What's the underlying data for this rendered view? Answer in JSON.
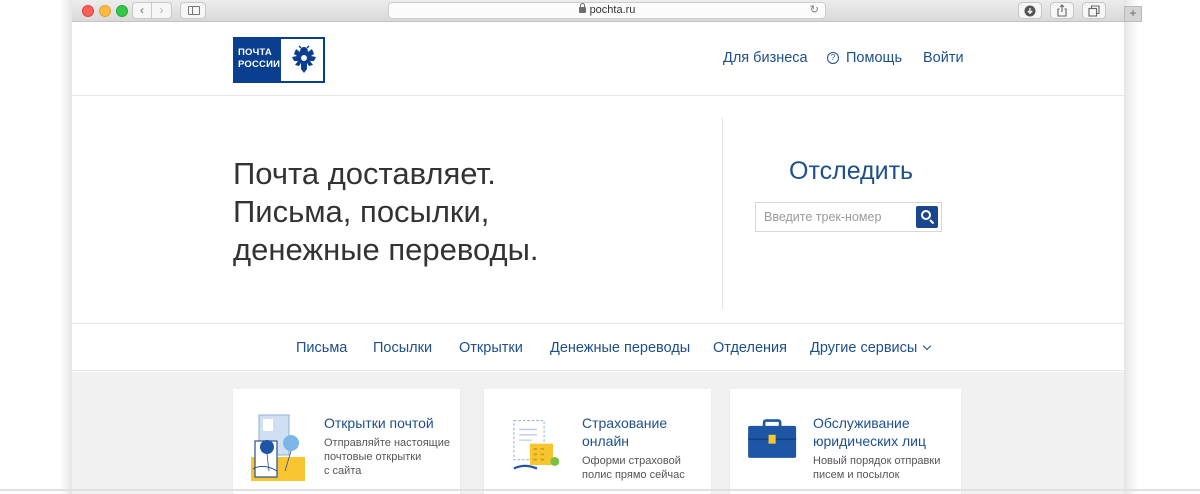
{
  "browser": {
    "url": "pochta.ru",
    "back_icon": "chevron-left-icon",
    "forward_icon": "chevron-right-icon",
    "reload_icon": "reload-icon",
    "plus_label": "+"
  },
  "header": {
    "logo_line1": "ПОЧТА",
    "logo_line2": "РОССИИ",
    "business_link": "Для бизнеса",
    "help_link": "Помощь",
    "login_link": "Войти"
  },
  "hero": {
    "line1": "Почта доставляет.",
    "line2": "Письма, посылки,",
    "line3": "денежные переводы.",
    "track_title": "Отследить",
    "track_placeholder": "Введите трек-номер"
  },
  "nav": {
    "items": [
      "Письма",
      "Посылки",
      "Открытки",
      "Денежные переводы",
      "Отделения",
      "Другие сервисы"
    ]
  },
  "cards": [
    {
      "title_line1": "Открытки почтой",
      "title_line2": "",
      "desc_line1": "Отправляйте настоящие",
      "desc_line2": "почтовые открытки",
      "desc_line3": "с сайта"
    },
    {
      "title_line1": "Страхование",
      "title_line2": "онлайн",
      "desc_line1": "Оформи страховой",
      "desc_line2": "полис прямо сейчас",
      "desc_line3": ""
    },
    {
      "title_line1": "Обслуживание",
      "title_line2": "юридических лиц",
      "desc_line1": "Новый порядок отправки",
      "desc_line2": "писем и посылок",
      "desc_line3": ""
    }
  ],
  "colors": {
    "brand_blue": "#0a3f8f",
    "link_blue": "#1d4f8c",
    "text_dark": "#333333",
    "cards_bg": "#f1f1f1"
  }
}
